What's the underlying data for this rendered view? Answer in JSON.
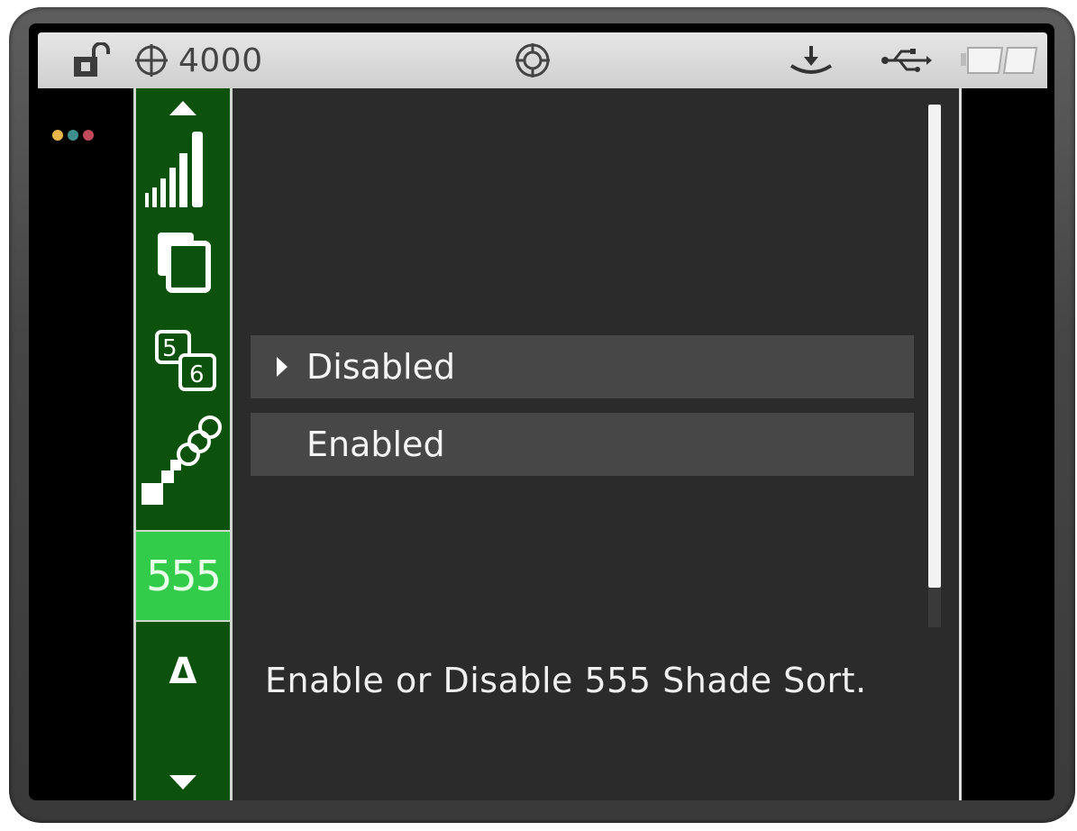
{
  "statusbar": {
    "reading": "4000",
    "icons": [
      "unlock-icon",
      "crosshair-icon",
      "target-icon",
      "calibration-icon",
      "usb-icon",
      "battery-icon"
    ]
  },
  "indicator_dots": [
    "#e8b64a",
    "#3f8f8f",
    "#c04a5a"
  ],
  "sidebar": {
    "items": [
      {
        "name": "scroll-up-icon"
      },
      {
        "name": "signal-bars-icon"
      },
      {
        "name": "copy-pages-icon"
      },
      {
        "name": "numbers-5-6-icon",
        "glyphs": [
          "5",
          "6"
        ]
      },
      {
        "name": "scatter-squares-icon"
      },
      {
        "name": "555-item",
        "label": "555",
        "active": true
      },
      {
        "name": "delta-item",
        "label": "Δ"
      },
      {
        "name": "scroll-down-icon"
      }
    ]
  },
  "options": [
    {
      "label": "Disabled",
      "selected": true
    },
    {
      "label": "Enabled",
      "selected": false
    }
  ],
  "help_text": "Enable or Disable 555 Shade Sort.",
  "colors": {
    "sidebar_bg": "#0c520c",
    "active_item": "#33cc4a",
    "panel_bg": "#2b2b2b",
    "option_bg": "#474747"
  }
}
